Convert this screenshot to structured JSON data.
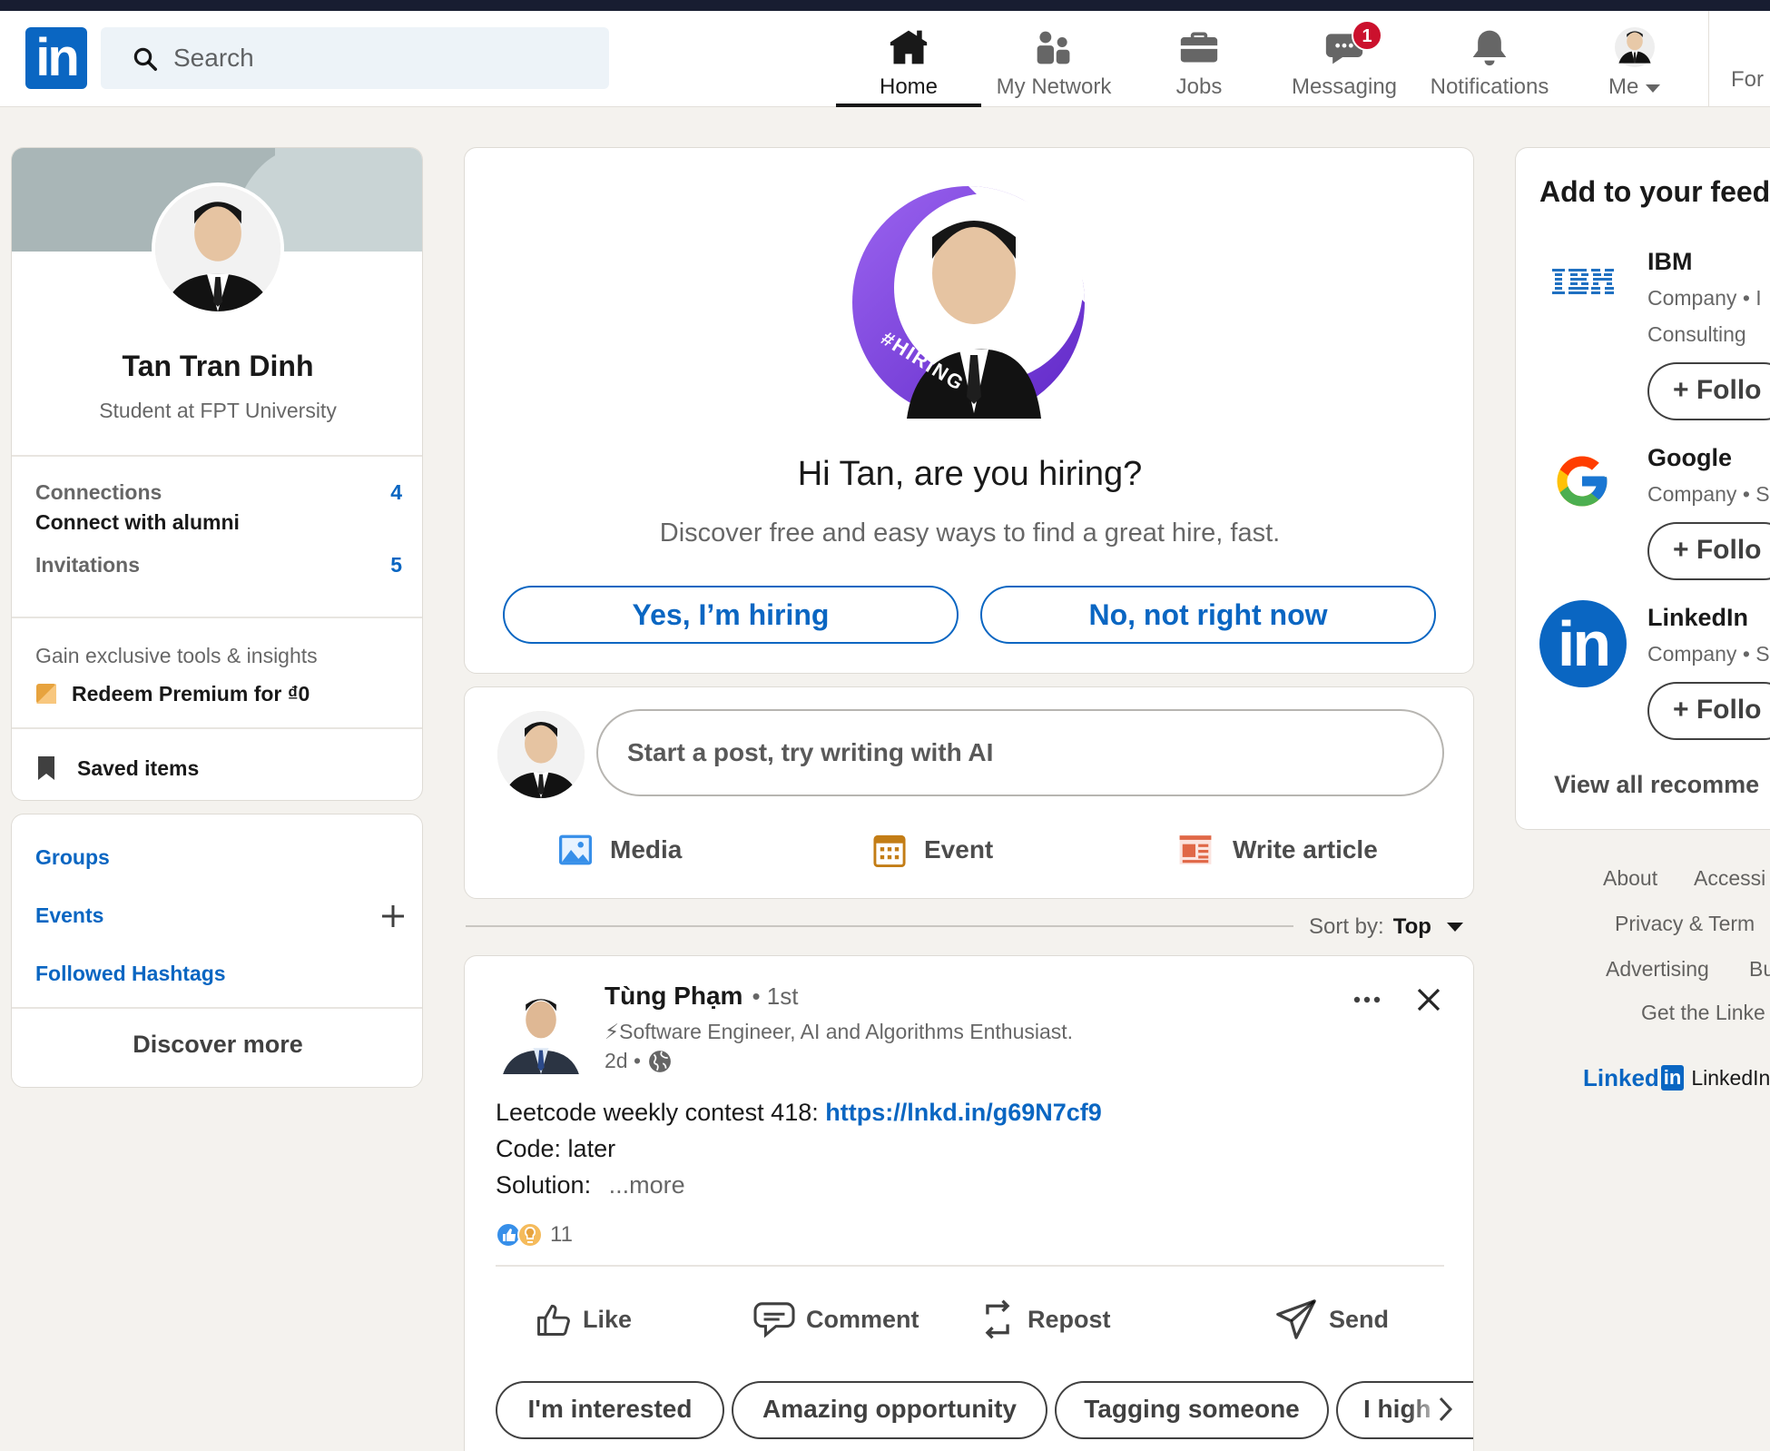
{
  "nav": {
    "logo": "in",
    "search_placeholder": "Search",
    "items": [
      {
        "label": "Home",
        "icon": "home-icon"
      },
      {
        "label": "My Network",
        "icon": "network-icon"
      },
      {
        "label": "Jobs",
        "icon": "briefcase-icon"
      },
      {
        "label": "Messaging",
        "icon": "messaging-icon",
        "badge": "1"
      },
      {
        "label": "Notifications",
        "icon": "bell-icon"
      },
      {
        "label": "Me",
        "icon": "me-avatar"
      }
    ],
    "for_business": "For"
  },
  "profile": {
    "name": "Tan Tran Dinh",
    "headline": "Student at FPT University",
    "connections_label": "Connections",
    "connections_sub": "Connect with alumni",
    "connections_count": "4",
    "invitations_label": "Invitations",
    "invitations_count": "5",
    "premium_text": "Gain exclusive tools & insights",
    "premium_cta": "Redeem Premium for ₫0",
    "saved": "Saved items"
  },
  "left_links": {
    "groups": "Groups",
    "events": "Events",
    "hashtags": "Followed Hashtags",
    "discover": "Discover more"
  },
  "hiring": {
    "badge_text": "#HIRING",
    "title": "Hi Tan, are you hiring?",
    "subtitle": "Discover free and easy ways to find a great hire, fast.",
    "yes": "Yes, I’m hiring",
    "no": "No, not right now"
  },
  "composer": {
    "placeholder": "Start a post, try writing with AI",
    "media": "Media",
    "event": "Event",
    "article": "Write article"
  },
  "sort": {
    "label": "Sort by:",
    "value": "Top"
  },
  "post": {
    "author": "Tùng Phạm",
    "degree": "• 1st",
    "headline": "⚡Software Engineer, AI and Algorithms Enthusiast.",
    "time": "2d •",
    "line1_text": "Leetcode weekly contest 418: ",
    "line1_link": "https://lnkd.in/g69N7cf9",
    "line2": "Code: later",
    "line3": "Solution:",
    "more": "...more",
    "reactions": "11",
    "actions": {
      "like": "Like",
      "comment": "Comment",
      "repost": "Repost",
      "send": "Send"
    },
    "quick_replies": [
      "I'm interested",
      "Amazing opportunity",
      "Tagging someone",
      "I high"
    ]
  },
  "feed": {
    "title": "Add to your feed",
    "items": [
      {
        "name": "IBM",
        "meta1": "Company • I",
        "meta2": "Consulting",
        "follow": "+ Follo"
      },
      {
        "name": "Google",
        "meta1": "Company • S",
        "follow": "+ Follo"
      },
      {
        "name": "LinkedIn",
        "meta1": "Company • S",
        "follow": "+ Follo"
      }
    ],
    "view_all": "View all recomme"
  },
  "footer": {
    "about": "About",
    "accessibility": "Accessi",
    "privacy": "Privacy & Term",
    "advertising": "Advertising",
    "business": "Bu",
    "get_app": "Get the Linke",
    "brand": "Linked",
    "brand_in": "in",
    "copyright": "LinkedIn"
  },
  "colors": {
    "brand": "#0a66c2",
    "background": "#f4f2ee",
    "hiring_purple": "#7a3ee0",
    "badge_red": "#cb112d"
  }
}
